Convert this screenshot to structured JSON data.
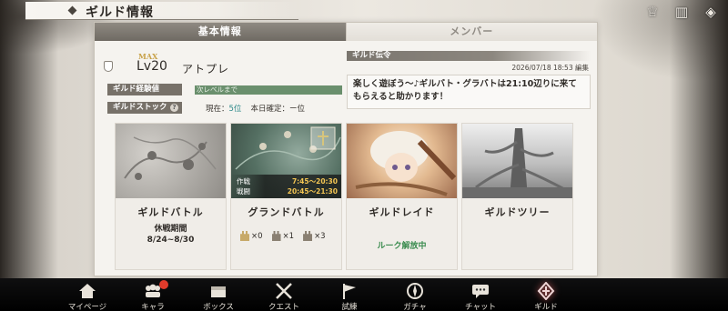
{
  "header": {
    "title": "ギルド情報",
    "icons": [
      {
        "name": "crown-icon",
        "glyph": "♕"
      },
      {
        "name": "book-icon",
        "glyph": "▥"
      },
      {
        "name": "tag-icon",
        "glyph": "◈"
      }
    ]
  },
  "tabs": [
    {
      "label": "基本情報",
      "active": true
    },
    {
      "label": "メンバー",
      "active": false
    }
  ],
  "guild": {
    "max_label": "MAX",
    "level": "Lv20",
    "name": "アトプレ"
  },
  "exp": {
    "label": "ギルド経験値",
    "bar_text": "次レベルまで",
    "fill_fraction": 1.0
  },
  "stock": {
    "label": "ギルドストック",
    "current_label": "現在：",
    "current_rank": "5位",
    "confirmed_label": "本日確定：",
    "confirmed_value": "ー位"
  },
  "message": {
    "header": "ギルド伝令",
    "timestamp": "2026/07/18 18:53",
    "edit_label": "編集",
    "body": "楽しく遊ぼう～♪ギルバト・グラバトは21:10辺りに来てもらえると助かります！"
  },
  "cards": {
    "battle": {
      "name": "ギルドバトル",
      "status": "休戦期間",
      "period": "8/24~8/30"
    },
    "grand": {
      "name": "グランドバトル",
      "schedule": [
        {
          "label": "作戦",
          "time": "7:45～20:30"
        },
        {
          "label": "戦闘",
          "time": "20:45～21:30"
        }
      ],
      "towers": [
        {
          "count": "×0",
          "color": "gold"
        },
        {
          "count": "×1",
          "color": "brown"
        },
        {
          "count": "×3",
          "color": "brown"
        }
      ]
    },
    "raid": {
      "name": "ギルドレイド",
      "status": "ルーク解放中"
    },
    "tree": {
      "name": "ギルドツリー"
    }
  },
  "nav": [
    {
      "label": "マイページ",
      "icon": "home-icon",
      "badge": false,
      "active": false
    },
    {
      "label": "キャラ",
      "icon": "characters-icon",
      "badge": true,
      "active": false
    },
    {
      "label": "ボックス",
      "icon": "box-icon",
      "badge": false,
      "active": false
    },
    {
      "label": "クエスト",
      "icon": "swords-icon",
      "badge": false,
      "active": false
    },
    {
      "label": "試練",
      "icon": "flag-icon",
      "badge": false,
      "active": false
    },
    {
      "label": "ガチャ",
      "icon": "gacha-icon",
      "badge": false,
      "active": false
    },
    {
      "label": "チャット",
      "icon": "chat-icon",
      "badge": false,
      "active": false
    },
    {
      "label": "ギルド",
      "icon": "guild-icon",
      "badge": false,
      "active": true
    }
  ],
  "colors": {
    "accent_green": "#3b8c4f",
    "rank_teal": "#2f8a8a",
    "max_gold": "#c8a24a",
    "badge_red": "#e03b2b"
  }
}
